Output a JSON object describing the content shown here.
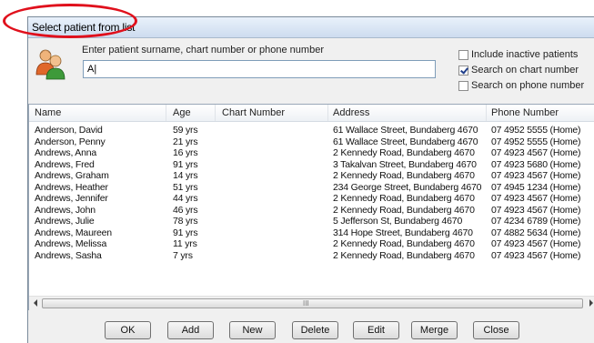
{
  "window": {
    "title": "Select patient from list"
  },
  "search": {
    "prompt": "Enter patient surname, chart number or phone number",
    "value": "A|"
  },
  "options": [
    {
      "label": "Include inactive patients",
      "checked": false
    },
    {
      "label": "Search on chart number",
      "checked": true
    },
    {
      "label": "Search on phone number",
      "checked": false
    }
  ],
  "table": {
    "columns": [
      "Name",
      "Age",
      "Chart Number",
      "Address",
      "Phone Number"
    ],
    "rows": [
      [
        "Anderson, David",
        "59 yrs",
        "",
        "61 Wallace Street, Bundaberg 4670",
        "07 4952 5555 (Home)"
      ],
      [
        "Anderson, Penny",
        "21 yrs",
        "",
        "61 Wallace Street, Bundaberg 4670",
        "07 4952 5555 (Home)"
      ],
      [
        "Andrews, Anna",
        "16 yrs",
        "",
        "2 Kennedy Road, Bundaberg 4670",
        "07 4923 4567 (Home)"
      ],
      [
        "Andrews, Fred",
        "91 yrs",
        "",
        "3 Takalvan Street, Bundaberg 4670",
        "07 4923 5680 (Home)"
      ],
      [
        "Andrews, Graham",
        "14 yrs",
        "",
        "2 Kennedy Road, Bundaberg 4670",
        "07 4923 4567 (Home)"
      ],
      [
        "Andrews, Heather",
        "51 yrs",
        "",
        "234 George Street, Bundaberg 4670",
        "07 4945 1234 (Home)"
      ],
      [
        "Andrews, Jennifer",
        "44 yrs",
        "",
        "2 Kennedy Road, Bundaberg 4670",
        "07 4923 4567 (Home)"
      ],
      [
        "Andrews, John",
        "46 yrs",
        "",
        "2 Kennedy Road, Bundaberg 4670",
        "07 4923 4567 (Home)"
      ],
      [
        "Andrews, Julie",
        "78 yrs",
        "",
        "5 Jefferson St, Bundaberg 4670",
        "07 4234 6789 (Home)"
      ],
      [
        "Andrews, Maureen",
        "91 yrs",
        "",
        "314 Hope Street, Bundaberg 4670",
        "07 4882 5634 (Home)"
      ],
      [
        "Andrews, Melissa",
        "11 yrs",
        "",
        "2 Kennedy Road, Bundaberg 4670",
        "07 4923 4567 (Home)"
      ],
      [
        "Andrews, Sasha",
        "7 yrs",
        "",
        "2 Kennedy Road, Bundaberg 4670",
        "07 4923 4567 (Home)"
      ]
    ]
  },
  "scrollbar": {
    "grip": "III"
  },
  "buttons": [
    "OK",
    "Add",
    "New",
    "Delete",
    "Edit",
    "Merge",
    "Close"
  ],
  "colors": {
    "highlight_oval": "#e0101c",
    "titlebar": "#d7e4f4"
  },
  "icons": {
    "patient": "patients-icon"
  }
}
